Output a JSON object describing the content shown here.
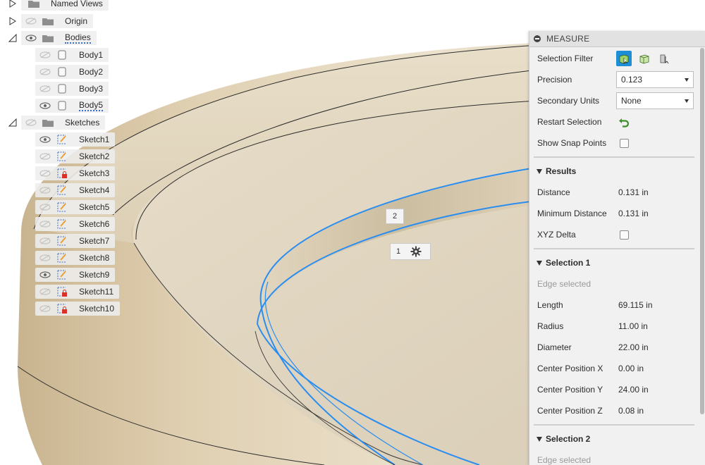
{
  "browser": {
    "named_views": "Named Views",
    "origin": "Origin",
    "bodies": "Bodies",
    "body_items": [
      "Body1",
      "Body2",
      "Body3",
      "Body5"
    ],
    "sketches": "Sketches",
    "sketch_items": [
      "Sketch1",
      "Sketch2",
      "Sketch3",
      "Sketch4",
      "Sketch5",
      "Sketch6",
      "Sketch7",
      "Sketch8",
      "Sketch9",
      "Sketch11",
      "Sketch10"
    ]
  },
  "viewport": {
    "edge_label_1": "1",
    "edge_label_2": "2",
    "selection_color": "#2a8df0",
    "body_color": "#e0d4bd"
  },
  "measure": {
    "title": "MEASURE",
    "selection_filter_label": "Selection Filter",
    "precision_label": "Precision",
    "precision_value": "0.123",
    "secondary_units_label": "Secondary Units",
    "secondary_units_value": "None",
    "restart_selection_label": "Restart Selection",
    "show_snap_points_label": "Show Snap Points",
    "results": {
      "title": "Results",
      "distance_label": "Distance",
      "distance_value": "0.131 in",
      "min_distance_label": "Minimum Distance",
      "min_distance_value": "0.131 in",
      "xyz_delta_label": "XYZ Delta"
    },
    "selection1": {
      "title": "Selection 1",
      "status": "Edge selected",
      "length_label": "Length",
      "length_value": "69.115 in",
      "radius_label": "Radius",
      "radius_value": "11.00 in",
      "diameter_label": "Diameter",
      "diameter_value": "22.00 in",
      "cx_label": "Center Position X",
      "cx_value": "0.00 in",
      "cy_label": "Center Position Y",
      "cy_value": "24.00 in",
      "cz_label": "Center Position Z",
      "cz_value": "0.08 in"
    },
    "selection2": {
      "title": "Selection 2",
      "status": "Edge selected"
    },
    "accent_color": "#1e8fd6"
  }
}
